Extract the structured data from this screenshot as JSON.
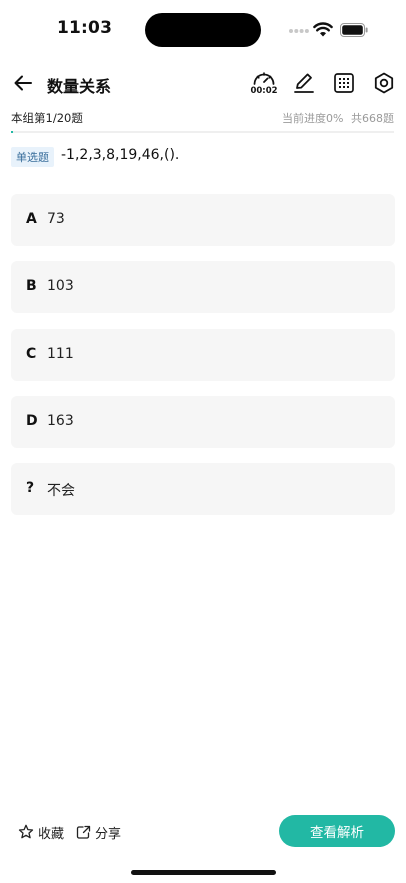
{
  "status_bar": {
    "time": "11:03"
  },
  "nav": {
    "title": "数量关系",
    "timer": "00:02"
  },
  "progress": {
    "group_text": "本组第1/20题",
    "current_progress": "当前进度0%",
    "total": "共668题",
    "percent": 0
  },
  "question": {
    "type": "单选题",
    "text": "-1,2,3,8,19,46,()."
  },
  "options": [
    {
      "letter": "A",
      "text": "73"
    },
    {
      "letter": "B",
      "text": "103"
    },
    {
      "letter": "C",
      "text": "111"
    },
    {
      "letter": "D",
      "text": "163"
    },
    {
      "letter": "?",
      "text": "不会"
    }
  ],
  "bottom": {
    "favorite_label": "收藏",
    "share_label": "分享",
    "analysis_label": "查看解析"
  },
  "colors": {
    "accent": "#22b8a4",
    "option_bg": "#f6f6f6",
    "tag_bg": "#e8f2fb",
    "tag_text": "#3a6f9c"
  }
}
